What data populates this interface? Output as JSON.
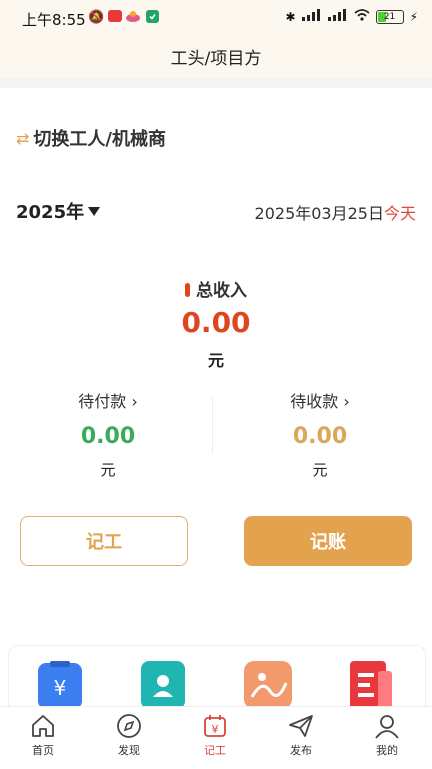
{
  "status_bar": {
    "time": "上午8:55",
    "battery": "21",
    "signal_label": "HD"
  },
  "header": {
    "title": "工头/项目方"
  },
  "switch": {
    "label": "切换工人/机械商"
  },
  "year_selector": {
    "label": "2025年"
  },
  "date": {
    "text": "2025年03月25日",
    "today": "今天"
  },
  "summary": {
    "total_label": "总收入",
    "total_value": "0.00",
    "total_unit": "元",
    "payable": {
      "label": "待付款",
      "value": "0.00",
      "unit": "元"
    },
    "receivable": {
      "label": "待收款",
      "value": "0.00",
      "unit": "元"
    }
  },
  "buttons": {
    "record_work": "记工",
    "record_account": "记账"
  },
  "tabs": [
    {
      "label": "首页"
    },
    {
      "label": "发现"
    },
    {
      "label": "记工"
    },
    {
      "label": "发布"
    },
    {
      "label": "我的"
    }
  ],
  "colors": {
    "accent": "#e3a24e",
    "income": "#e0451f",
    "payable": "#3aaa5c",
    "receivable": "#dba65a",
    "active_tab": "#d9463a"
  }
}
